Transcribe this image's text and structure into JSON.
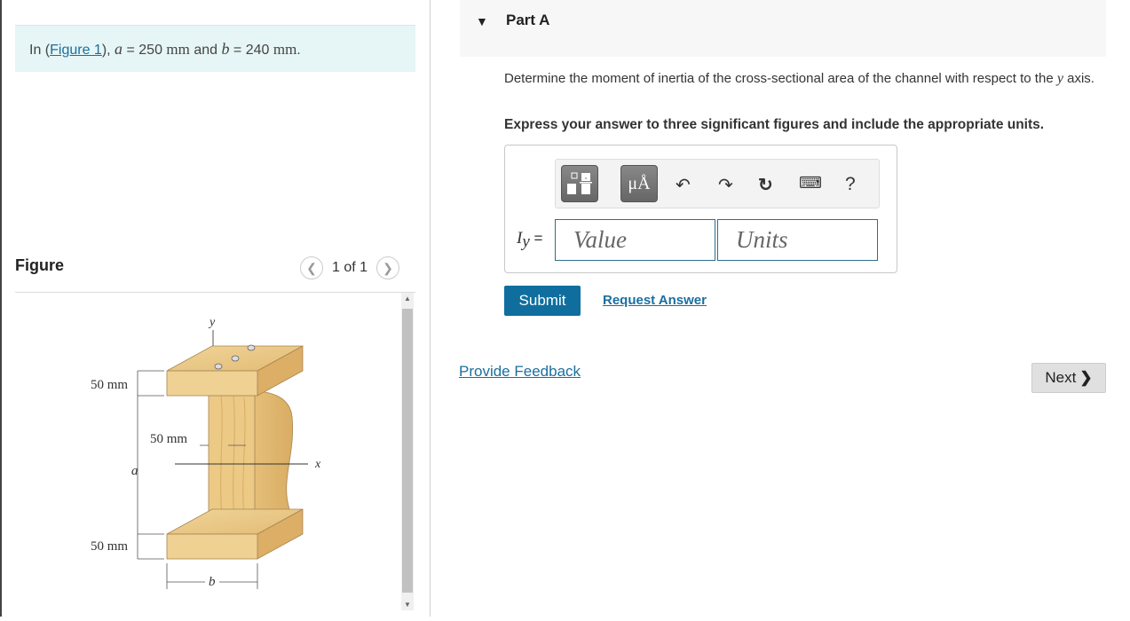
{
  "intro": {
    "prefix": "In (",
    "figure_link": "Figure 1",
    "mid": "), ",
    "var_a": "a",
    "eq_a": " = 250 ",
    "unit_a": "mm",
    "and": " and ",
    "var_b": "b",
    "eq_b": " = 240 ",
    "unit_b": "mm",
    "end": "."
  },
  "figure": {
    "heading": "Figure",
    "pager_text": "1 of 1",
    "labels": {
      "top_flange": "50 mm",
      "web": "50 mm",
      "bottom_flange": "50 mm",
      "a": "a",
      "b": "b",
      "x": "x",
      "y": "y"
    },
    "wood_color": "#eac98a"
  },
  "part": {
    "title": "Part A",
    "question_main": "Determine the moment of inertia of the cross-sectional area of the channel with respect to the ",
    "question_var": "y",
    "question_end": " axis.",
    "instruction": "Express your answer to three significant figures and include the appropriate units."
  },
  "answer": {
    "label_var": "I",
    "label_sub": "y",
    "label_eq": " =",
    "value_placeholder": "Value",
    "units_placeholder": "Units",
    "toolbar": {
      "units_btn": "μÅ",
      "help": "?"
    }
  },
  "actions": {
    "submit": "Submit",
    "request_answer": "Request Answer",
    "provide_feedback": "Provide Feedback",
    "next": "Next"
  }
}
